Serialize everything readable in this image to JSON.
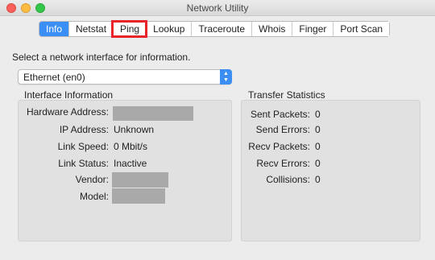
{
  "window": {
    "title": "Network Utility"
  },
  "tabs": [
    {
      "label": "Info",
      "active": true
    },
    {
      "label": "Netstat"
    },
    {
      "label": "Ping",
      "highlighted": true
    },
    {
      "label": "Lookup"
    },
    {
      "label": "Traceroute"
    },
    {
      "label": "Whois"
    },
    {
      "label": "Finger"
    },
    {
      "label": "Port Scan"
    }
  ],
  "interface_select": {
    "prompt": "Select a network interface for information.",
    "selected": "Ethernet (en0)"
  },
  "interface_info": {
    "title": "Interface Information",
    "fields": [
      {
        "label": "Hardware Address:",
        "value": ""
      },
      {
        "label": "IP Address:",
        "value": "Unknown"
      },
      {
        "label": "Link Speed:",
        "value": "0 Mbit/s"
      },
      {
        "label": "Link Status:",
        "value": "Inactive"
      },
      {
        "label": "Vendor:",
        "value": ""
      },
      {
        "label": "Model:",
        "value": ""
      }
    ]
  },
  "transfer_stats": {
    "title": "Transfer Statistics",
    "fields": [
      {
        "label": "Sent Packets:",
        "value": "0"
      },
      {
        "label": "Send Errors:",
        "value": "0"
      },
      {
        "label": "Recv Packets:",
        "value": "0"
      },
      {
        "label": "Recv Errors:",
        "value": "0"
      },
      {
        "label": "Collisions:",
        "value": "0"
      }
    ]
  },
  "colors": {
    "accent": "#3b8ef3",
    "highlight": "#e8232a",
    "redaction": "#a9a9a9"
  }
}
